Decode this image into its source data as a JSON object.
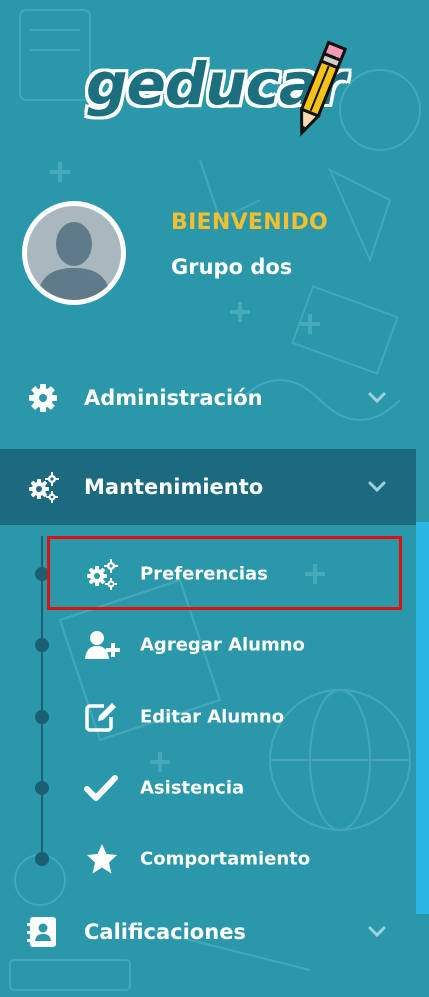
{
  "brand": {
    "logo_text": "geducar"
  },
  "colors": {
    "background": "#2a97ab",
    "active_bg": "#1b6a80",
    "accent": "#f2c02f",
    "highlight": "#e01010"
  },
  "profile": {
    "welcome": "BIENVENIDO",
    "name": "Grupo dos"
  },
  "menu": {
    "administracion": {
      "label": "Administración",
      "icon": "gear-icon"
    },
    "mantenimiento": {
      "label": "Mantenimiento",
      "icon": "gears-icon"
    },
    "calificaciones": {
      "label": "Calificaciones",
      "icon": "address-book-icon"
    }
  },
  "submenu": [
    {
      "label": "Preferencias",
      "icon": "gears-icon"
    },
    {
      "label": "Agregar Alumno",
      "icon": "add-user-icon"
    },
    {
      "label": "Editar Alumno",
      "icon": "edit-icon"
    },
    {
      "label": "Asistencia",
      "icon": "check-icon"
    },
    {
      "label": "Comportamiento",
      "icon": "star-icon"
    }
  ]
}
